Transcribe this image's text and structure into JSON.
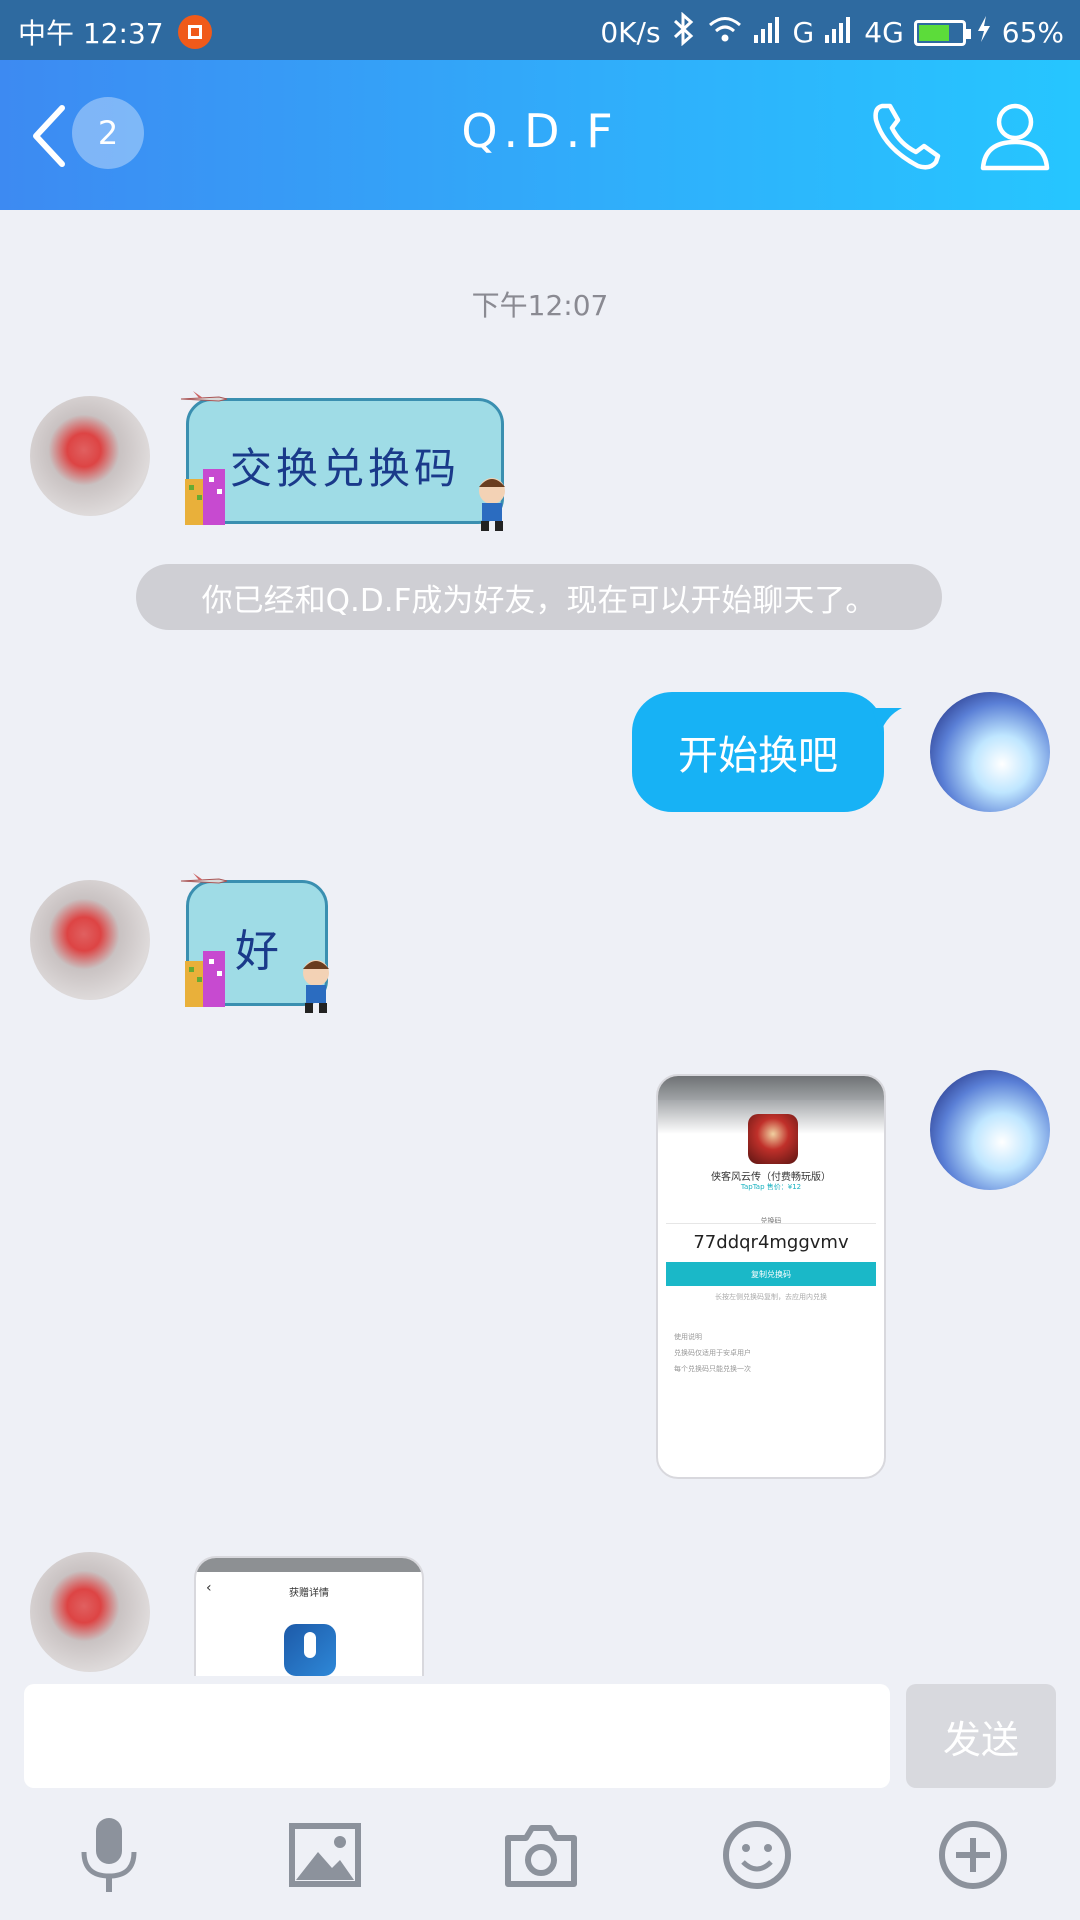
{
  "status_bar": {
    "time": "中午 12:37",
    "net_speed": "0K/s",
    "signal_1": "G",
    "signal_2": "4G",
    "battery_pct_text": "65%",
    "battery_level": 0.65
  },
  "header": {
    "unread_count": "2",
    "title": "Q.D.F"
  },
  "chat": {
    "timestamp": "下午12:07",
    "sticker_1_text": "交换兑换码",
    "system_message": "你已经和Q.D.F成为好友，现在可以开始聊天了。",
    "my_message": "开始换吧",
    "sticker_2_text": "好",
    "image_1": {
      "game_name": "侠客风云传（付费畅玩版）",
      "game_sub": "TapTap 售价：¥12",
      "code_label": "兑换码",
      "code": "77ddqr4mggvmv",
      "copy_button": "复制兑换码",
      "tip": "长按左侧兑换码复制，去应用内兑换",
      "rules_title": "使用说明",
      "rule_1": "兑换码仅适用于安卓用户",
      "rule_2": "每个兑换码只能兑换一次"
    },
    "image_2": {
      "header": "获赠详情"
    }
  },
  "composer": {
    "send_label": "发送"
  },
  "colors": {
    "header_start": "#3d8af2",
    "header_end": "#26c6ff",
    "my_bubble": "#17b2f5",
    "background": "#eef0f6"
  }
}
